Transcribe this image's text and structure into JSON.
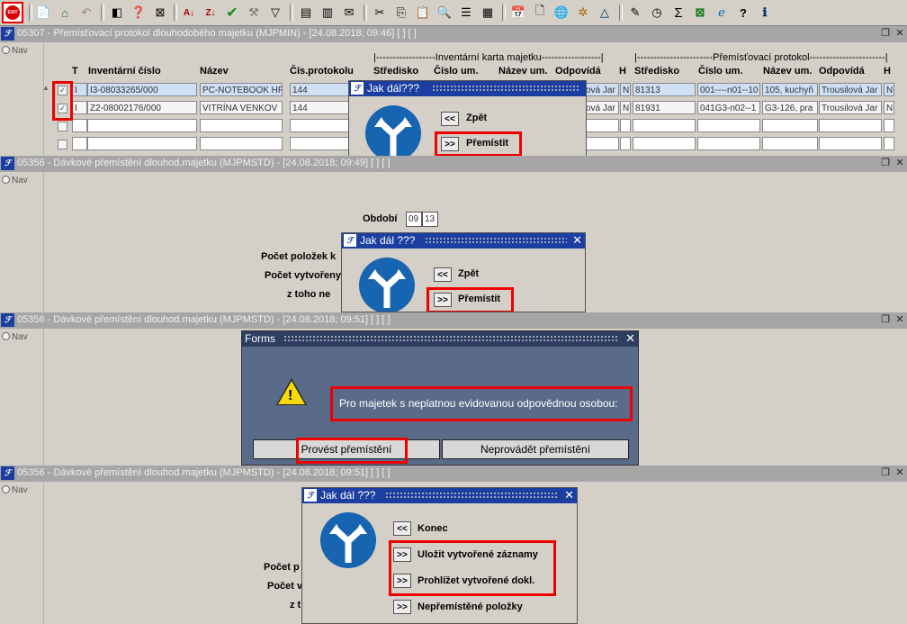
{
  "exit_label": "EXIT",
  "toolbar_icons": [
    "exit-icon",
    "new-record-icon",
    "save-icon",
    "undo-icon",
    "filter-icon",
    "query-icon",
    "delete-query-icon",
    "sort-asc-icon",
    "sort-desc-icon",
    "check-icon",
    "wrench-icon",
    "funnel-icon",
    "print-icon",
    "print-preview-icon",
    "mail-icon",
    "cut-icon",
    "copy-icon",
    "paste-icon",
    "zoom-icon",
    "tree-icon",
    "grid-icon",
    "calendar-icon",
    "document-icon",
    "globe-icon",
    "network-icon",
    "chart-icon",
    "edit-icon",
    "clock-icon",
    "sum-icon",
    "excel-icon",
    "internet-icon",
    "help-icon",
    "info-icon"
  ],
  "window1": {
    "title": "05307 - Přemísťovací protokol dlouhodobého majetku (MJPMIN) - [24.08.2018; 09:46]  [ ]  [ ]",
    "nav": "Nav",
    "group_card": "|------------------Inventární karta majetku------------------|",
    "group_protocol": "|-----------------------Přemísťovací protokol-----------------------|",
    "headers": {
      "t": "T",
      "inv": "Inventární číslo",
      "nazev": "Název",
      "protokol": "Čís.protokolu",
      "stredisko": "Středisko",
      "cislo_um": "Číslo um.",
      "nazev_um": "Název um.",
      "odpovida": "Odpovídá",
      "h": "H",
      "stredisko2": "Středisko",
      "cislo_um2": "Číslo um.",
      "nazev_um2": "Název um.",
      "odpovida2": "Odpovídá",
      "h2": "H"
    },
    "rows": [
      {
        "t": "I",
        "inv": "I3-08033265/000",
        "nazev": "PC-NOTEBOOK HP",
        "protokol": "144",
        "odpovida": "ová Jar",
        "h": "N",
        "stredisko2": "81313",
        "cislo_um2": "001----n01--10",
        "nazev_um2": "105, kuchyň",
        "odpovida2": "Trousilová Jar",
        "h2": "N"
      },
      {
        "t": "I",
        "inv": "Z2-08002176/000",
        "nazev": "VITRÍNA VENKOV",
        "protokol": "144",
        "odpovida": "ová Jar",
        "h": "N",
        "stredisko2": "81931",
        "cislo_um2": "041G3-n02--1",
        "nazev_um2": "G3-126, pra",
        "odpovida2": "Trousilová Jar",
        "h2": "N"
      }
    ],
    "dialog": {
      "title": "Jak dál???",
      "back_symbol": "<<",
      "back": "Zpět",
      "move_symbol": ">>",
      "move": "Přemístit"
    }
  },
  "window2": {
    "title": "05356 - Dávkové přemístění dlouhod.majetku (MJPMSTD) - [24.08.2018; 09:49]  [ ]  [ ]",
    "nav": "Nav",
    "obdobi_label": "Období",
    "obdobi_month": "09",
    "obdobi_year": "13",
    "label1": "Počet položek k",
    "label2": "Počet vytvořeny",
    "label3": "z toho      ne",
    "dialog": {
      "title": "Jak dál ???",
      "back_symbol": "<<",
      "back": "Zpět",
      "move_symbol": ">>",
      "move": "Přemístit"
    }
  },
  "window3": {
    "title": "05356 - Dávkové přemístění dlouhod.majetku (MJPMSTD) - [24.08.2018; 09:51]  [ ]  [ ]",
    "nav": "Nav",
    "forms_dialog": {
      "title": "Forms",
      "message": "Pro majetek s neplatnou evidovanou odpovědnou osobou:",
      "do_move": "Provést přemístění",
      "dont_move": "Neprovádět přemístění"
    }
  },
  "window4": {
    "title": "05356 - Dávkové přemístění dlouhod.majetku (MJPMSTD) - [24.08.2018; 09:51]  [ ]  [ ]",
    "nav": "Nav",
    "label1": "Počet p",
    "label2": "Počet v",
    "label3": "z t",
    "dialog": {
      "title": "Jak dál ???",
      "end_symbol": "<<",
      "end": "Konec",
      "save_symbol": ">>",
      "save": "Uložit vytvořené záznamy",
      "browse_symbol": ">>",
      "browse": "Prohlížet vytvořené dokl.",
      "unmoved_symbol": ">>",
      "unmoved": "Nepřemístěné položky"
    }
  },
  "colors": {
    "title_bar": "#1c3ea0",
    "highlight": "#e00000",
    "selected_row": "#cfe0f5",
    "sign_blue": "#1764b0"
  }
}
